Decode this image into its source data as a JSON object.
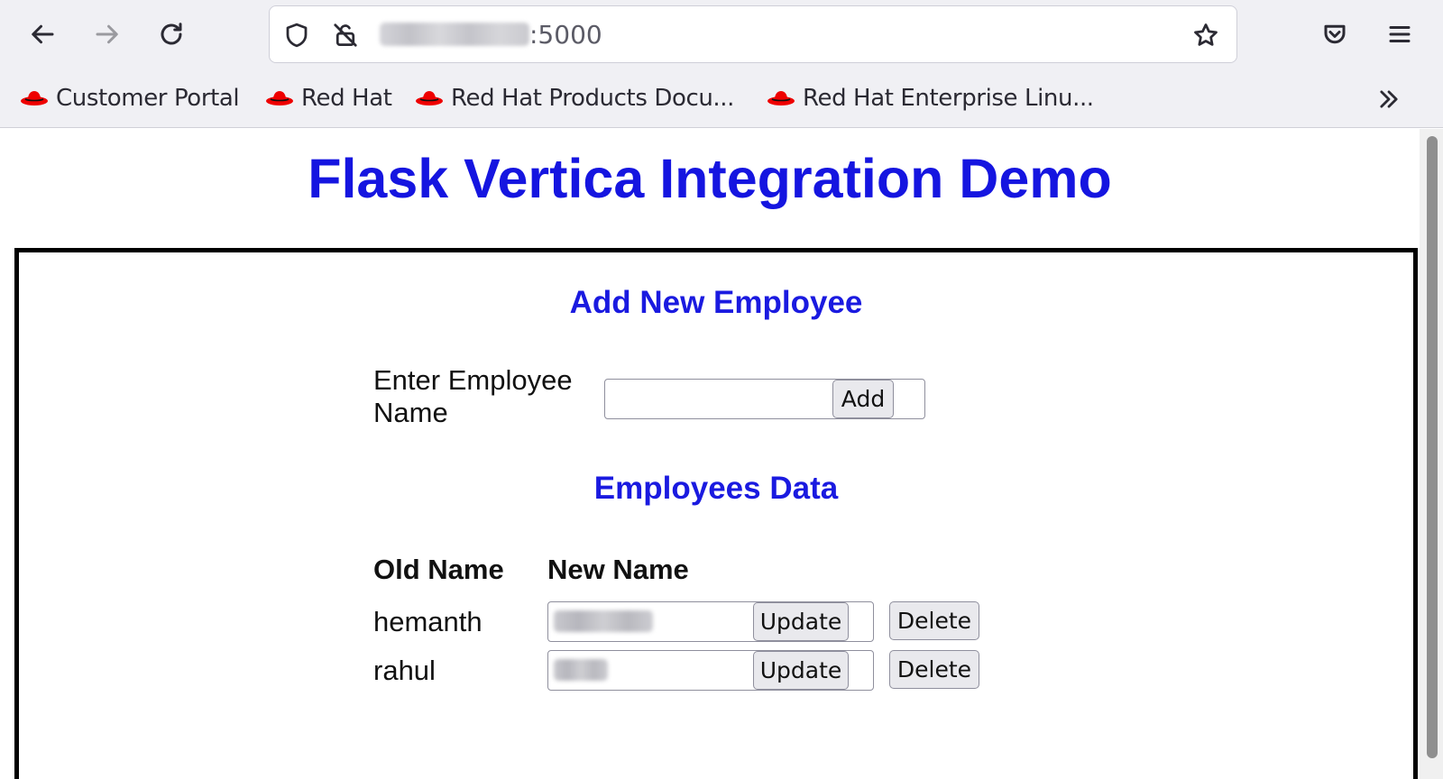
{
  "browser": {
    "url_suffix": ":5000",
    "bookmarks": [
      {
        "label": "Customer Portal"
      },
      {
        "label": "Red Hat"
      },
      {
        "label": "Red Hat Products Docu..."
      },
      {
        "label": "Red Hat Enterprise Linu..."
      }
    ],
    "accent_color": "#ee0000"
  },
  "page": {
    "title": "Flask Vertica Integration Demo",
    "title_color": "#1515e0"
  },
  "add_section": {
    "heading": "Add New Employee",
    "label_line1": "Enter Employee",
    "label_line2": "Name",
    "input_value": "",
    "add_label": "Add"
  },
  "employees_section": {
    "heading": "Employees Data",
    "columns": [
      "Old Name",
      "New Name"
    ],
    "rows": [
      {
        "old_name": "hemanth",
        "update_label": "Update",
        "delete_label": "Delete"
      },
      {
        "old_name": "rahul",
        "update_label": "Update",
        "delete_label": "Delete"
      }
    ]
  }
}
